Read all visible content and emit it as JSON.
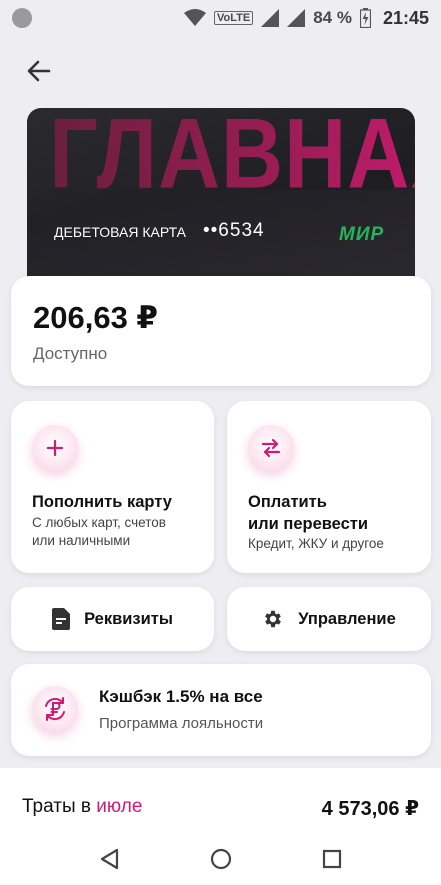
{
  "status_bar": {
    "network_label": "VoLTE",
    "battery": "84 %",
    "time": "21:45"
  },
  "card": {
    "banner_word": "ГЛАВНАЯ",
    "type": "ДЕБЕТОВАЯ КАРТА",
    "number": "••6534",
    "payment_system": "МИР"
  },
  "balance": {
    "amount": "206,63 ₽",
    "label": "Доступно"
  },
  "actions": {
    "top_up": {
      "title": "Пополнить карту",
      "subtitle_line1": "С любых карт, счетов",
      "subtitle_line2": "или наличными"
    },
    "pay": {
      "title_line1": "Оплатить",
      "title_line2": "или перевести",
      "subtitle": "Кредит, ЖКУ и другое"
    },
    "details_label": "Реквизиты",
    "manage_label": "Управление"
  },
  "cashback": {
    "title": "Кэшбэк 1.5% на все",
    "subtitle": "Программа лояльности"
  },
  "spending": {
    "prefix": "Траты в",
    "month": "июле",
    "amount": "4 573,06 ₽"
  },
  "colors": {
    "accent": "#d11a75",
    "background": "#ededf2",
    "card_dark": "#2b2a30",
    "mir_green": "#29b35a"
  }
}
